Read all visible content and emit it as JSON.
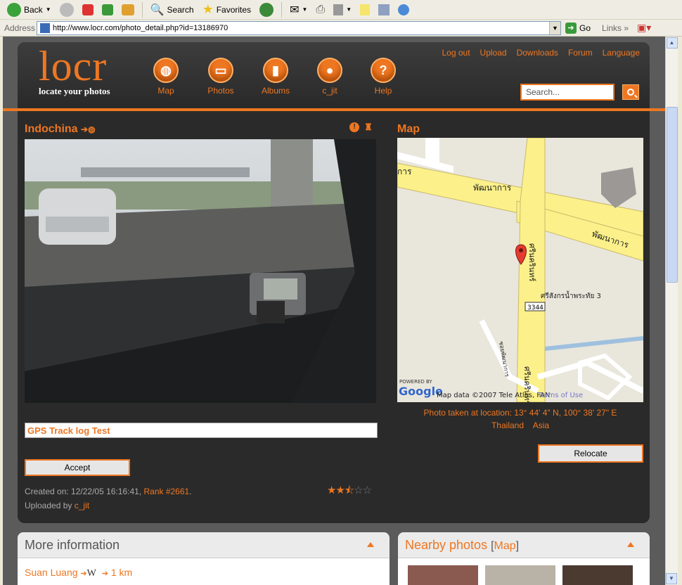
{
  "browser": {
    "toolbar": {
      "back": "Back",
      "search": "Search",
      "favorites": "Favorites"
    },
    "address_label": "Address",
    "url": "http://www.locr.com/photo_detail.php?id=13186970",
    "go": "Go",
    "links": "Links"
  },
  "site": {
    "logo": "locr",
    "tagline": "locate your photos",
    "nav": [
      {
        "label": "Map",
        "icon": "globe-icon"
      },
      {
        "label": "Photos",
        "icon": "photos-icon"
      },
      {
        "label": "Albums",
        "icon": "albums-icon"
      },
      {
        "label": "c_jit",
        "icon": "user-icon"
      },
      {
        "label": "Help",
        "icon": "help-icon"
      }
    ],
    "top_links": [
      "Log out",
      "Upload",
      "Downloads",
      "Forum",
      "Language"
    ],
    "search_placeholder": "Search..."
  },
  "photo": {
    "title": "Indochina",
    "caption": "GPS Track log Test",
    "accept": "Accept",
    "created": "Created on: 12/22/05 16:16:41,",
    "rank": "Rank #2661",
    "uploaded_by": "Uploaded by",
    "user": "c_jit",
    "rating": 2.5,
    "rating_max": 5
  },
  "map": {
    "title": "Map",
    "location_text": "Photo taken at location: 13° 44' 4\" N, 100° 38' 27\" E",
    "country": "Thailand",
    "continent": "Asia",
    "relocate": "Relocate",
    "labels": {
      "road1": "พัฒนาการ",
      "road2": "พัฒนาการ",
      "road3": "ศรีนครินทร์",
      "place": "ศรีสังกรน้ำพระทัย 3",
      "route": "3344",
      "left": "การ",
      "side_road": "ซอยพัฒนาการ",
      "road4": "ศรีนครินทร์",
      "powered": "POWERED BY",
      "google": "Google",
      "copyright": "Map data ©2007 Tele Atlas, FAN",
      "terms": "Terms of Use"
    }
  },
  "more_info": {
    "title": "More information",
    "place": "Suan Luang",
    "dir": "W",
    "distance": "1 km"
  },
  "nearby": {
    "title": "Nearby photos",
    "map_link": "Map"
  }
}
